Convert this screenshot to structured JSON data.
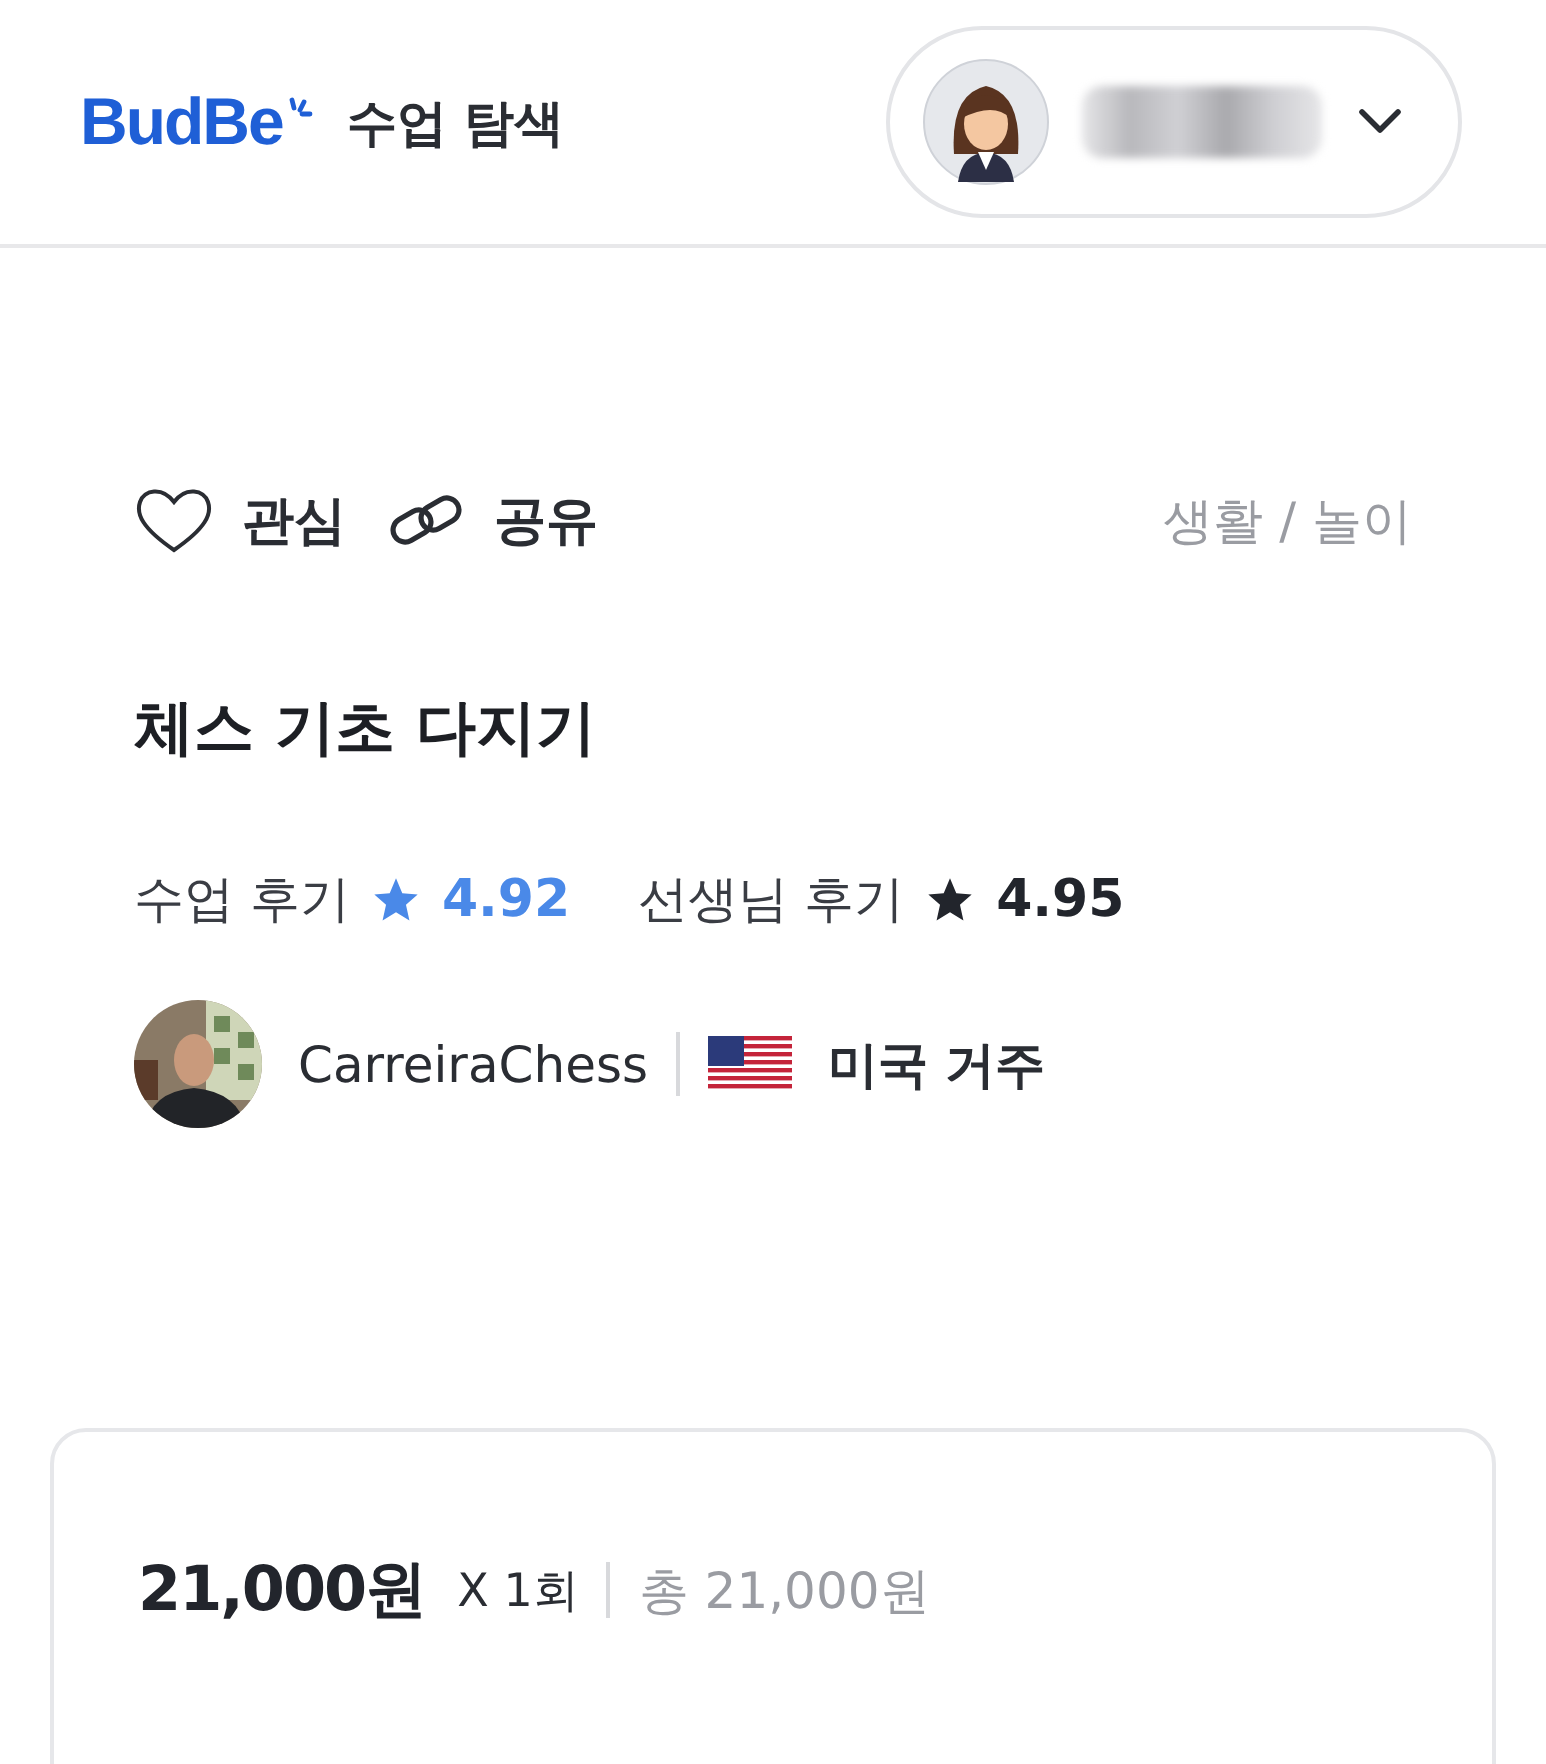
{
  "header": {
    "logo": "BudBe",
    "nav_link": "수업 탐색"
  },
  "actions": [
    {
      "kind": "heart",
      "label": "관심"
    },
    {
      "kind": "link",
      "label": "공유"
    }
  ],
  "category": "생활 / 놀이",
  "title": "체스 기초 다지기",
  "ratings": [
    {
      "label": "수업 후기",
      "value": "4.92",
      "color": "#4a89e8"
    },
    {
      "label": "선생님 후기",
      "value": "4.95",
      "color": "#22252c"
    }
  ],
  "teacher": {
    "name": "CarreiraChess",
    "location": "미국 거주"
  },
  "price": {
    "unit_price": "21,000원",
    "quantity": "X 1회",
    "total": "총 21,000원"
  }
}
